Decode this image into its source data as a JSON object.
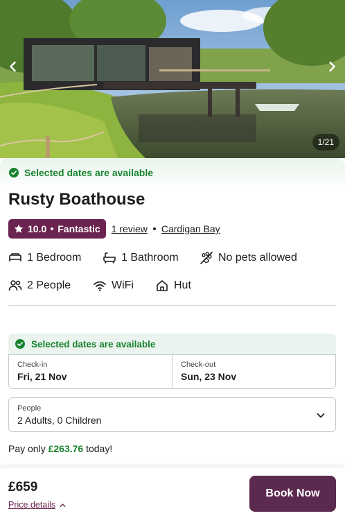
{
  "gallery": {
    "counter": "1/21",
    "prev_icon": "chevron-left-icon",
    "next_icon": "chevron-right-icon"
  },
  "availability": {
    "text": "Selected dates are available",
    "icon": "check-circle-icon"
  },
  "property": {
    "title": "Rusty Boathouse",
    "rating_score": "10.0",
    "rating_label": "Fantastic",
    "reviews_link": "1 review",
    "location_link": "Cardigan Bay"
  },
  "amenities": {
    "bedroom": "1 Bedroom",
    "bathroom": "1 Bathroom",
    "pets": "No pets allowed",
    "people": "2 People",
    "wifi": "WiFi",
    "type": "Hut"
  },
  "booking": {
    "availability_text": "Selected dates are available",
    "checkin_label": "Check-in",
    "checkin_value": "Fri, 21 Nov",
    "checkout_label": "Check-out",
    "checkout_value": "Sun, 23 Nov",
    "people_label": "People",
    "people_value": "2 Adults, 0 Children",
    "pay_prefix": "Pay only ",
    "pay_amount": "£263.76",
    "pay_suffix": " today!"
  },
  "footer": {
    "total": "£659",
    "price_details_link": "Price details",
    "book_button": "Book Now"
  },
  "colors": {
    "brand": "#5c2a4f",
    "rating_badge": "#6b2450",
    "success": "#19832f"
  }
}
